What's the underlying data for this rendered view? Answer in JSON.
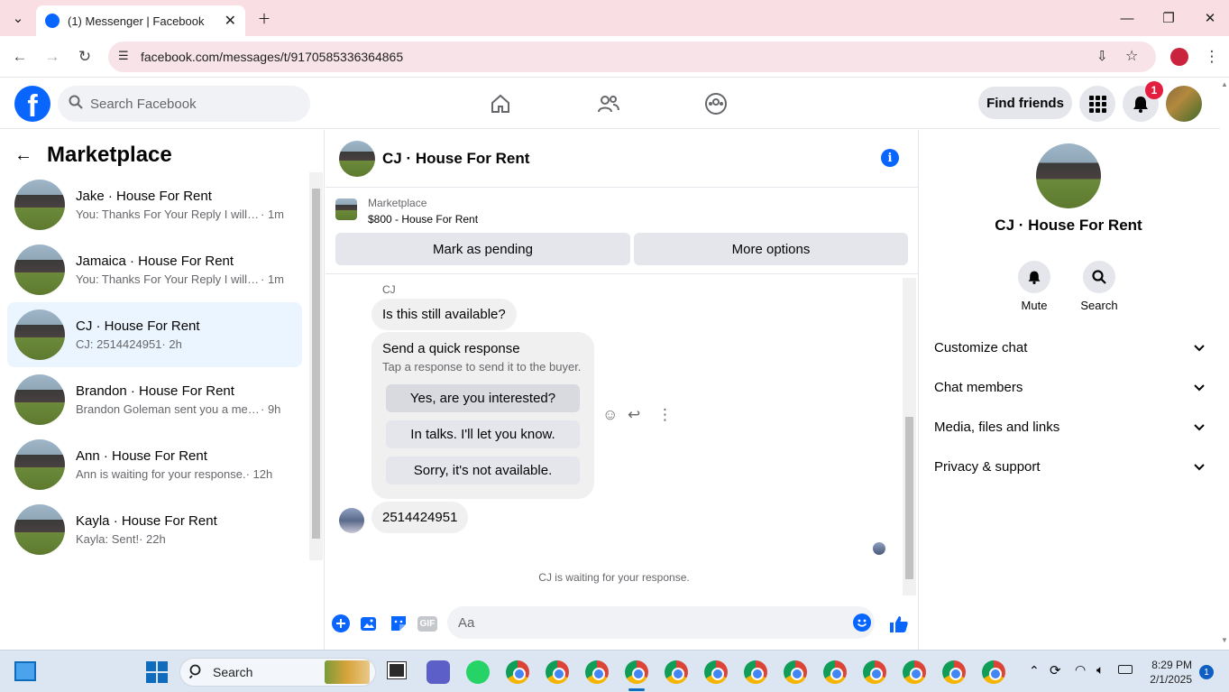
{
  "browser": {
    "tab_title": "(1) Messenger | Facebook",
    "url": "facebook.com/messages/t/9170585336364865"
  },
  "fb_header": {
    "logo": "f",
    "search_placeholder": "Search Facebook",
    "find_friends": "Find friends",
    "notification_count": "1"
  },
  "left": {
    "title": "Marketplace",
    "conversations": [
      {
        "name": "Jake · House For Rent",
        "preview": "You: Thanks For Your Reply I will C...",
        "time": "· 1m"
      },
      {
        "name": "Jamaica · House For Rent",
        "preview": "You: Thanks For Your Reply I will C...",
        "time": "· 1m"
      },
      {
        "name": "CJ · House For Rent",
        "preview": "CJ: 2514424951",
        "time": "· 2h"
      },
      {
        "name": "Brandon · House For Rent",
        "preview": "Brandon Goleman sent you a mess...",
        "time": "· 9h"
      },
      {
        "name": "Ann · House For Rent",
        "preview": "Ann is waiting for your response.",
        "time": "· 12h"
      },
      {
        "name": "Kayla · House For Rent",
        "preview": "Kayla: Sent!",
        "time": "· 22h"
      }
    ]
  },
  "chat": {
    "title": "CJ · House For Rent",
    "listing": {
      "source": "Marketplace",
      "item": "$800 - House For Rent"
    },
    "mark_pending": "Mark as pending",
    "more_options": "More options",
    "sender_label": "CJ",
    "message1": "Is this still available?",
    "quick": {
      "title": "Send a quick response",
      "subtitle": "Tap a response to send it to the buyer.",
      "options": [
        "Yes, are you interested?",
        "In talks. I'll let you know.",
        "Sorry, it's not available."
      ]
    },
    "message2": "2514424951",
    "waiting": "CJ is waiting for your response.",
    "composer_placeholder": "Aa",
    "gif": "GIF"
  },
  "right": {
    "name": "CJ · House For Rent",
    "mute": "Mute",
    "search": "Search",
    "sections": [
      "Customize chat",
      "Chat members",
      "Media, files and links",
      "Privacy & support"
    ]
  },
  "taskbar": {
    "search": "Search",
    "time": "8:29 PM",
    "date": "2/1/2025",
    "badge": "1"
  }
}
